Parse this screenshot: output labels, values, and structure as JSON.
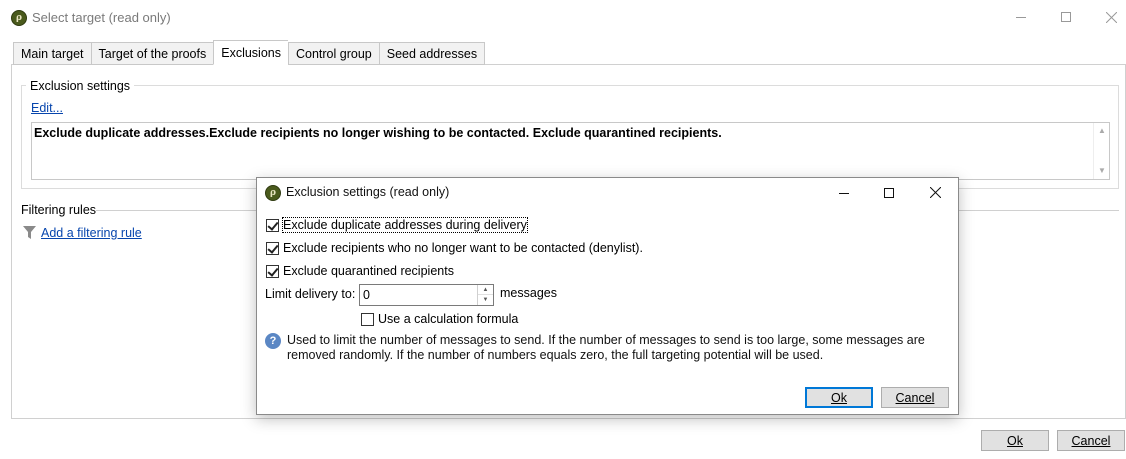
{
  "window": {
    "icon_glyph": "ρ",
    "title": "Select target (read only)"
  },
  "tabs": [
    {
      "label": "Main target"
    },
    {
      "label": "Target of the proofs"
    },
    {
      "label": "Exclusions"
    },
    {
      "label": "Control group"
    },
    {
      "label": "Seed addresses"
    }
  ],
  "exclusion_settings": {
    "group_label": "Exclusion settings",
    "edit_link": "Edit...",
    "summary": "Exclude duplicate addresses.Exclude recipients no longer wishing to be contacted. Exclude quarantined recipients."
  },
  "filtering": {
    "label": "Filtering rules",
    "add_rule_link": "Add a filtering rule"
  },
  "footer": {
    "ok_label": "Ok",
    "cancel_label": "Cancel"
  },
  "dialog": {
    "title": "Exclusion settings (read only)",
    "checkboxes": [
      {
        "label": "Exclude duplicate addresses during delivery",
        "checked": true
      },
      {
        "label": "Exclude recipients who no longer want to be contacted (denylist).",
        "checked": true
      },
      {
        "label": "Exclude quarantined recipients",
        "checked": true
      }
    ],
    "limit_label": "Limit delivery to:",
    "limit_value": "0",
    "limit_unit": "messages",
    "calc_formula_label": "Use a calculation formula",
    "calc_formula_checked": false,
    "info_text": "Used to limit the number of messages to send. If the number of messages to send is too large, some messages are removed randomly. If the number of numbers equals zero, the full targeting potential will be used.",
    "ok_label": "Ok",
    "cancel_label": "Cancel"
  },
  "icons": {
    "window_controls": [
      "minimize-icon",
      "maximize-icon",
      "close-icon"
    ],
    "filter": "funnel-icon",
    "info": "info-icon"
  },
  "colors": {
    "link": "#0645ad",
    "default_button_border": "#0078d7",
    "info_icon": "#5b87c4",
    "app_icon": "#4a5a1c"
  }
}
